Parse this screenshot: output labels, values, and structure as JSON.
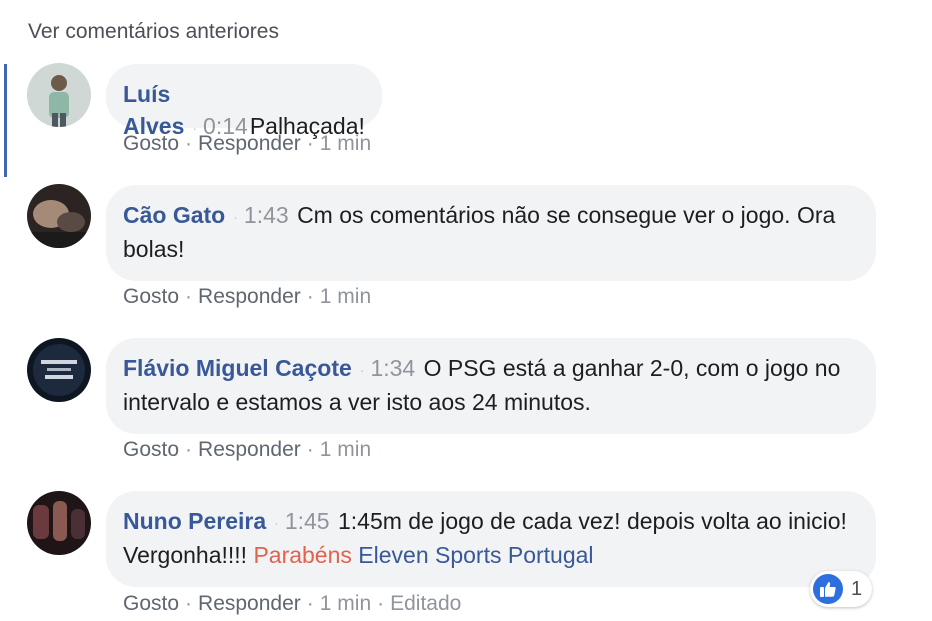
{
  "load_previous_label": "Ver comentários anteriores",
  "comments": [
    {
      "author": "Luís Alves",
      "timestamp": "0:14",
      "text": "Palhaçada!",
      "actions": {
        "like": "Gosto",
        "reply": "Responder",
        "time": "1 min"
      }
    },
    {
      "author": "Cão Gato",
      "timestamp": "1:43",
      "text": "Cm os comentários não se consegue ver o jogo. Ora bolas!",
      "actions": {
        "like": "Gosto",
        "reply": "Responder",
        "time": "1 min"
      }
    },
    {
      "author": "Flávio Miguel Caçote",
      "timestamp": "1:34",
      "text": "O PSG está a ganhar 2-0, com o jogo no intervalo e estamos a ver isto aos 24 minutos.",
      "actions": {
        "like": "Gosto",
        "reply": "Responder",
        "time": "1 min"
      }
    },
    {
      "author": "Nuno Pereira",
      "timestamp": "1:45",
      "text": "1:45m de jogo de cada vez! depois volta ao inicio! Vergonha!!!!",
      "mention_1": "Parabéns",
      "mention_2": "Eleven Sports Portugal",
      "actions": {
        "like": "Gosto",
        "reply": "Responder",
        "time": "1 min",
        "edited": "Editado"
      },
      "reaction": {
        "icon": "like-icon",
        "count": "1"
      }
    }
  ],
  "colors": {
    "author": "#385898",
    "mention_highlight": "#e0634e",
    "bubble_bg": "#f2f3f5",
    "meta": "#90949c"
  }
}
